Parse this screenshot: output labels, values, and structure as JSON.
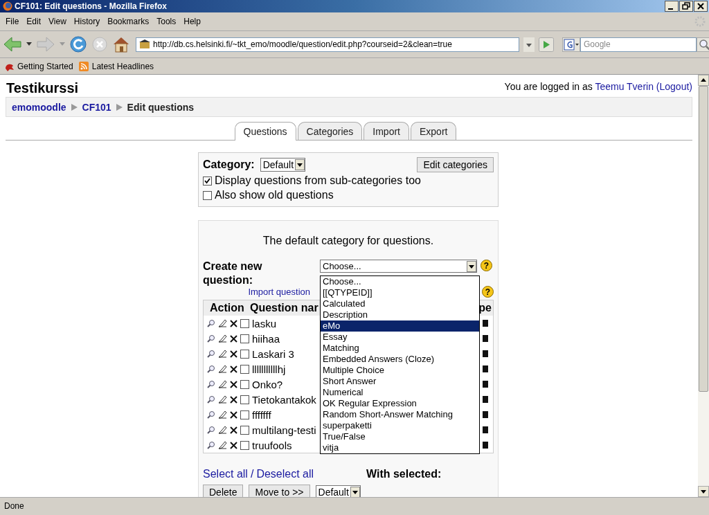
{
  "window": {
    "title": "CF101: Edit questions - Mozilla Firefox"
  },
  "menu": [
    "File",
    "Edit",
    "View",
    "History",
    "Bookmarks",
    "Tools",
    "Help"
  ],
  "address_bar": {
    "value": "http://db.cs.helsinki.fi/~tkt_emo/moodle/question/edit.php?courseid=2&clean=true"
  },
  "search": {
    "placeholder": "Google"
  },
  "bookmarks": [
    "Getting Started",
    "Latest Headlines"
  ],
  "page": {
    "course_title": "Testikurssi",
    "login": {
      "prefix": "You are logged in as",
      "user": "Teemu Tverin",
      "logout": "(Logout)"
    },
    "breadcrumb": [
      {
        "label": "emomoodle",
        "current": false
      },
      {
        "label": "CF101",
        "current": false
      },
      {
        "label": "Edit questions",
        "current": true
      }
    ],
    "tabs": [
      {
        "label": "Questions",
        "selected": true
      },
      {
        "label": "Categories",
        "selected": false
      },
      {
        "label": "Import",
        "selected": false
      },
      {
        "label": "Export",
        "selected": false
      }
    ],
    "category": {
      "label": "Category:",
      "value": "Default",
      "edit_button": "Edit categories",
      "options": [
        {
          "label": "Display questions from sub-categories too",
          "checked": true
        },
        {
          "label": "Also show old questions",
          "checked": false
        }
      ]
    },
    "panel": {
      "description": "The default category for questions.",
      "create_label": "Create new question:",
      "create_value": "Choose...",
      "create_help": "?",
      "dropdown": [
        {
          "label": "Choose...",
          "selected": false
        },
        {
          "label": "[[QTYPEID]]",
          "selected": false
        },
        {
          "label": "Calculated",
          "selected": false
        },
        {
          "label": "Description",
          "selected": false
        },
        {
          "label": "eMo",
          "selected": true
        },
        {
          "label": "Essay",
          "selected": false
        },
        {
          "label": "Matching",
          "selected": false
        },
        {
          "label": "Embedded Answers (Cloze)",
          "selected": false
        },
        {
          "label": "Multiple Choice",
          "selected": false
        },
        {
          "label": "Short Answer",
          "selected": false
        },
        {
          "label": "Numerical",
          "selected": false
        },
        {
          "label": "OK Regular Expression",
          "selected": false
        },
        {
          "label": "Random Short-Answer Matching",
          "selected": false
        },
        {
          "label": "superpaketti",
          "selected": false
        },
        {
          "label": "True/False",
          "selected": false
        },
        {
          "label": "vitja",
          "selected": false
        }
      ],
      "import_link": "Import question",
      "import_help": "?",
      "table": {
        "columns": [
          "Action",
          "Question nar",
          "pe"
        ],
        "rows": [
          {
            "name": "lasku",
            "checked": false
          },
          {
            "name": "hiihaa",
            "checked": false
          },
          {
            "name": "Laskari 3",
            "checked": false
          },
          {
            "name": "lllllllllllhj",
            "checked": false
          },
          {
            "name": "Onko?",
            "checked": false
          },
          {
            "name": "Tietokantakok",
            "checked": false
          },
          {
            "name": "fffffff",
            "checked": false
          },
          {
            "name": "multilang-testi",
            "checked": false
          },
          {
            "name": "truufools",
            "checked": false
          }
        ]
      },
      "select_all": "Select all",
      "separator": "/",
      "deselect_all": "Deselect all",
      "with_selected": "With selected:",
      "buttons": [
        "Delete",
        "Move to >>"
      ],
      "move_target": "Default"
    }
  },
  "status_bar": "Done"
}
